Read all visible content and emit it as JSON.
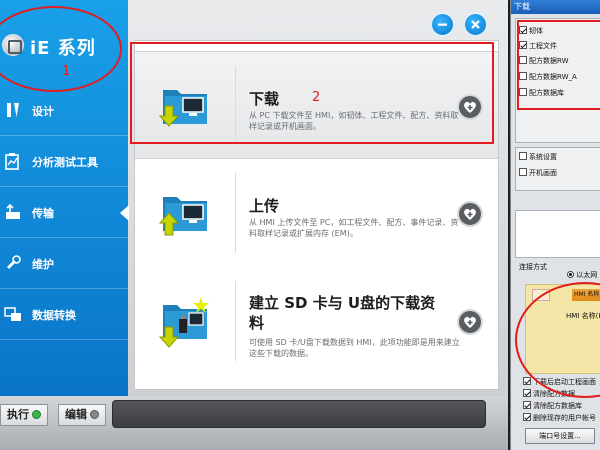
{
  "sidebar": {
    "brand": "iE 系列",
    "items": [
      {
        "label": "设计"
      },
      {
        "label": "分析测试工具"
      },
      {
        "label": "传输"
      },
      {
        "label": "维护"
      },
      {
        "label": "数据转换"
      }
    ]
  },
  "content": {
    "cards": [
      {
        "title": "下载",
        "desc": "从 PC 下载文件至 HMI，如韧体、工程文件、配方、资料取样记录或开机画面。"
      },
      {
        "title": "上传",
        "desc": "从 HMI 上传文件至 PC，如工程文件、配方、事件记录、资料取样记录或扩展内存 (EM)。"
      },
      {
        "title": "建立 SD 卡与 U盘的下载资料",
        "desc": "可使用 SD 卡/U盘下载数据到 HMI，此项功能即是用来建立这些下载的数据。"
      }
    ]
  },
  "bottombar": {
    "exec_label": "执行",
    "edit_label": "编辑"
  },
  "annotations": {
    "label1": "1",
    "label2": "2"
  },
  "dialog": {
    "title": "下载",
    "checks_top": [
      {
        "label": "韧体",
        "checked": true
      },
      {
        "label": "工程文件",
        "checked": true
      },
      {
        "label": "配方数据RW",
        "checked": false
      },
      {
        "label": "配方数据RW_A",
        "checked": false
      },
      {
        "label": "配方数据库",
        "checked": false
      }
    ],
    "checks_mid": [
      {
        "label": "系统设置",
        "checked": false
      },
      {
        "label": "开机画面",
        "checked": false
      }
    ],
    "connection_label": "连接方式",
    "connection_option": "以太网",
    "hmi_tab_b": "HMI 名称",
    "hmi_name_label": "HMI 名称(H):",
    "checks_bottom": [
      {
        "label": "下载后启动工程画面",
        "checked": true
      },
      {
        "label": "清除配方数据",
        "checked": true
      },
      {
        "label": "清除配方数据库",
        "checked": true
      },
      {
        "label": "删除现存的用户帐号",
        "checked": true
      }
    ],
    "port_button": "端口号设置..."
  },
  "colors": {
    "sidebar_blue": "#0f8fe0",
    "annotation_red": "#e21d1d",
    "exec_dot": "#39b54a"
  }
}
